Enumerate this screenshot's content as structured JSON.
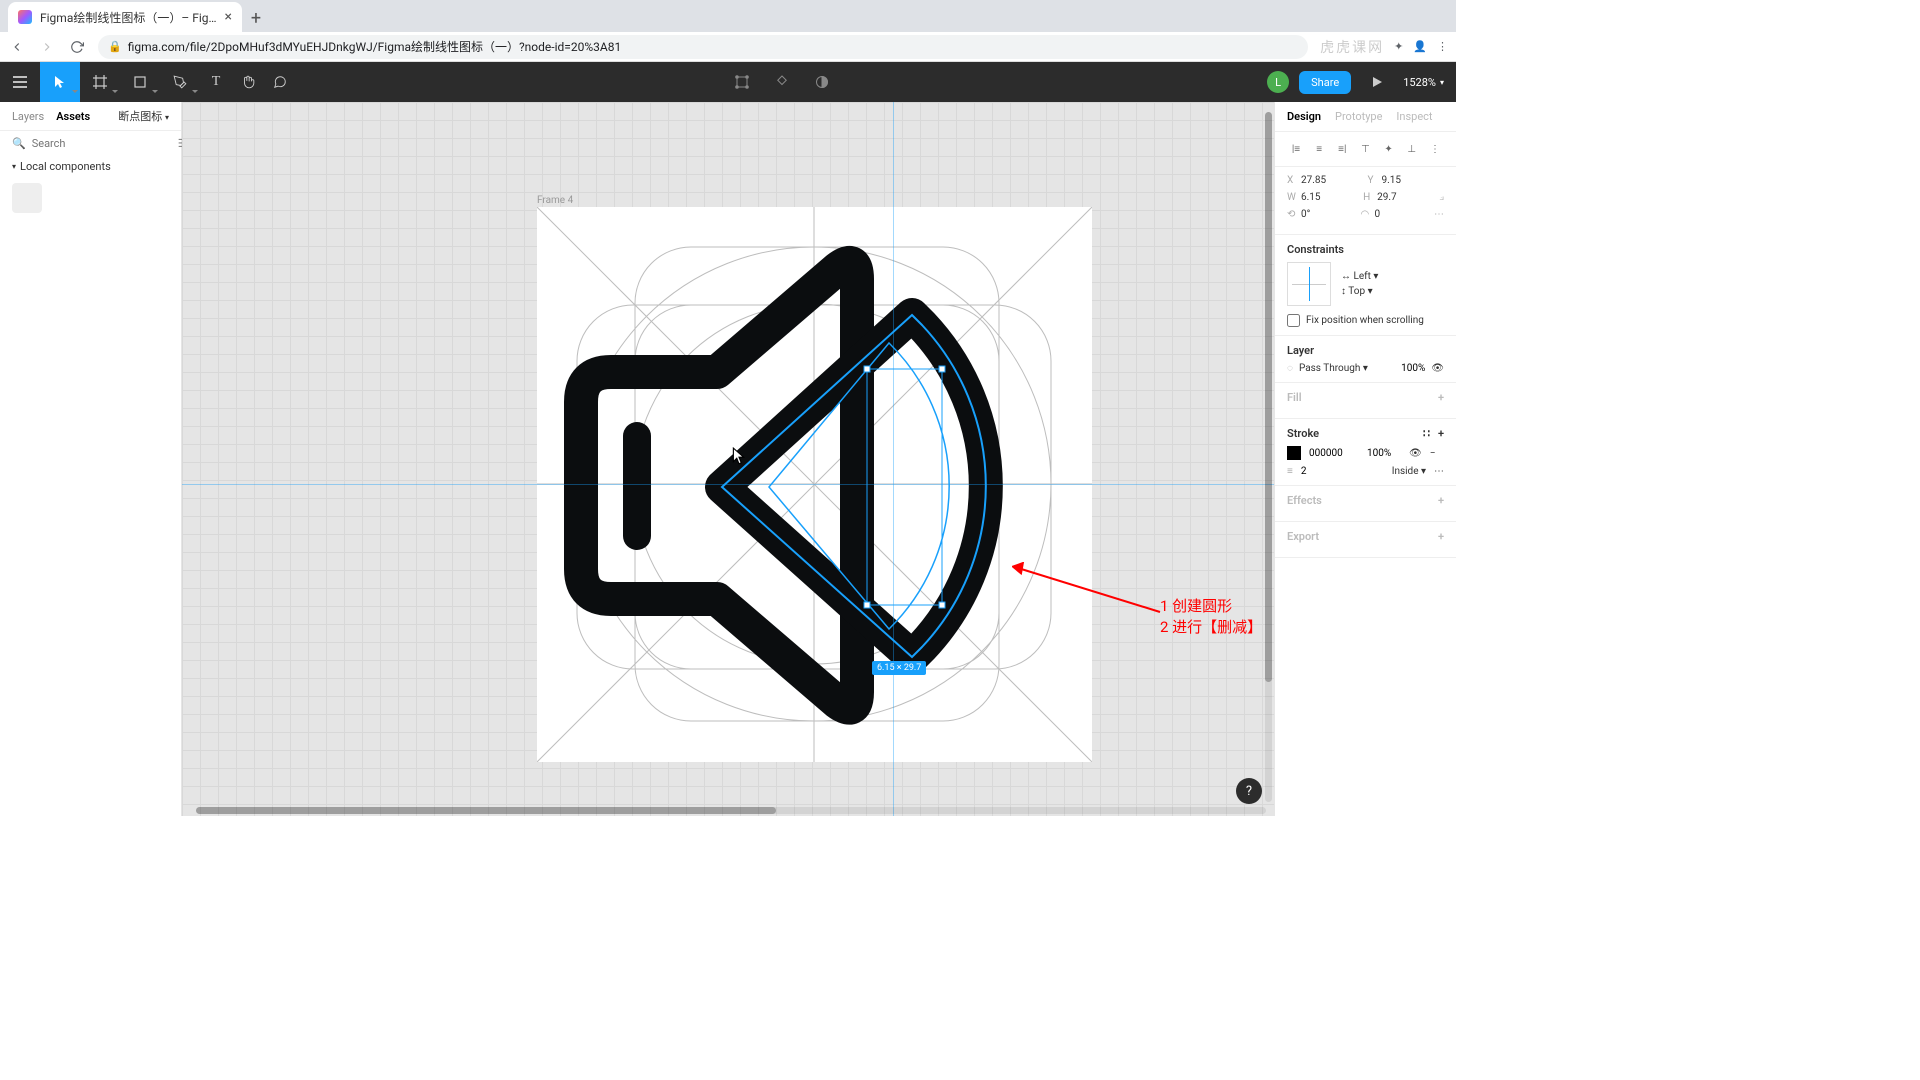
{
  "browser": {
    "tab_title": "Figma绘制线性图标（一）– Fig…",
    "url": "figma.com/file/2DpoMHuf3dMYuEHJDnkgWJ/Figma绘制线性图标（一）?node-id=20%3A81",
    "watermark": "虎虎课网"
  },
  "toolbar": {
    "share": "Share",
    "zoom": "1528%",
    "avatar_letter": "L"
  },
  "left": {
    "tab_layers": "Layers",
    "tab_assets": "Assets",
    "page": "断点图标",
    "search_placeholder": "Search",
    "local_components": "Local components"
  },
  "canvas": {
    "frame_label": "Frame 4",
    "selection_size": "6.15 × 29.7",
    "annotation_line1": "1 创建圆形",
    "annotation_line2": "2 进行【删减】"
  },
  "right": {
    "tab_design": "Design",
    "tab_prototype": "Prototype",
    "tab_inspect": "Inspect",
    "x": "27.85",
    "y": "9.15",
    "w": "6.15",
    "h": "29.7",
    "rot": "0°",
    "radius": "0",
    "constraints_title": "Constraints",
    "constraint_h": "Left",
    "constraint_v": "Top",
    "fix_scroll": "Fix position when scrolling",
    "layer_title": "Layer",
    "blend": "Pass Through",
    "opacity": "100%",
    "fill_title": "Fill",
    "stroke_title": "Stroke",
    "stroke_color": "000000",
    "stroke_opacity": "100%",
    "stroke_weight": "2",
    "stroke_align": "Inside",
    "effects_title": "Effects",
    "export_title": "Export"
  }
}
